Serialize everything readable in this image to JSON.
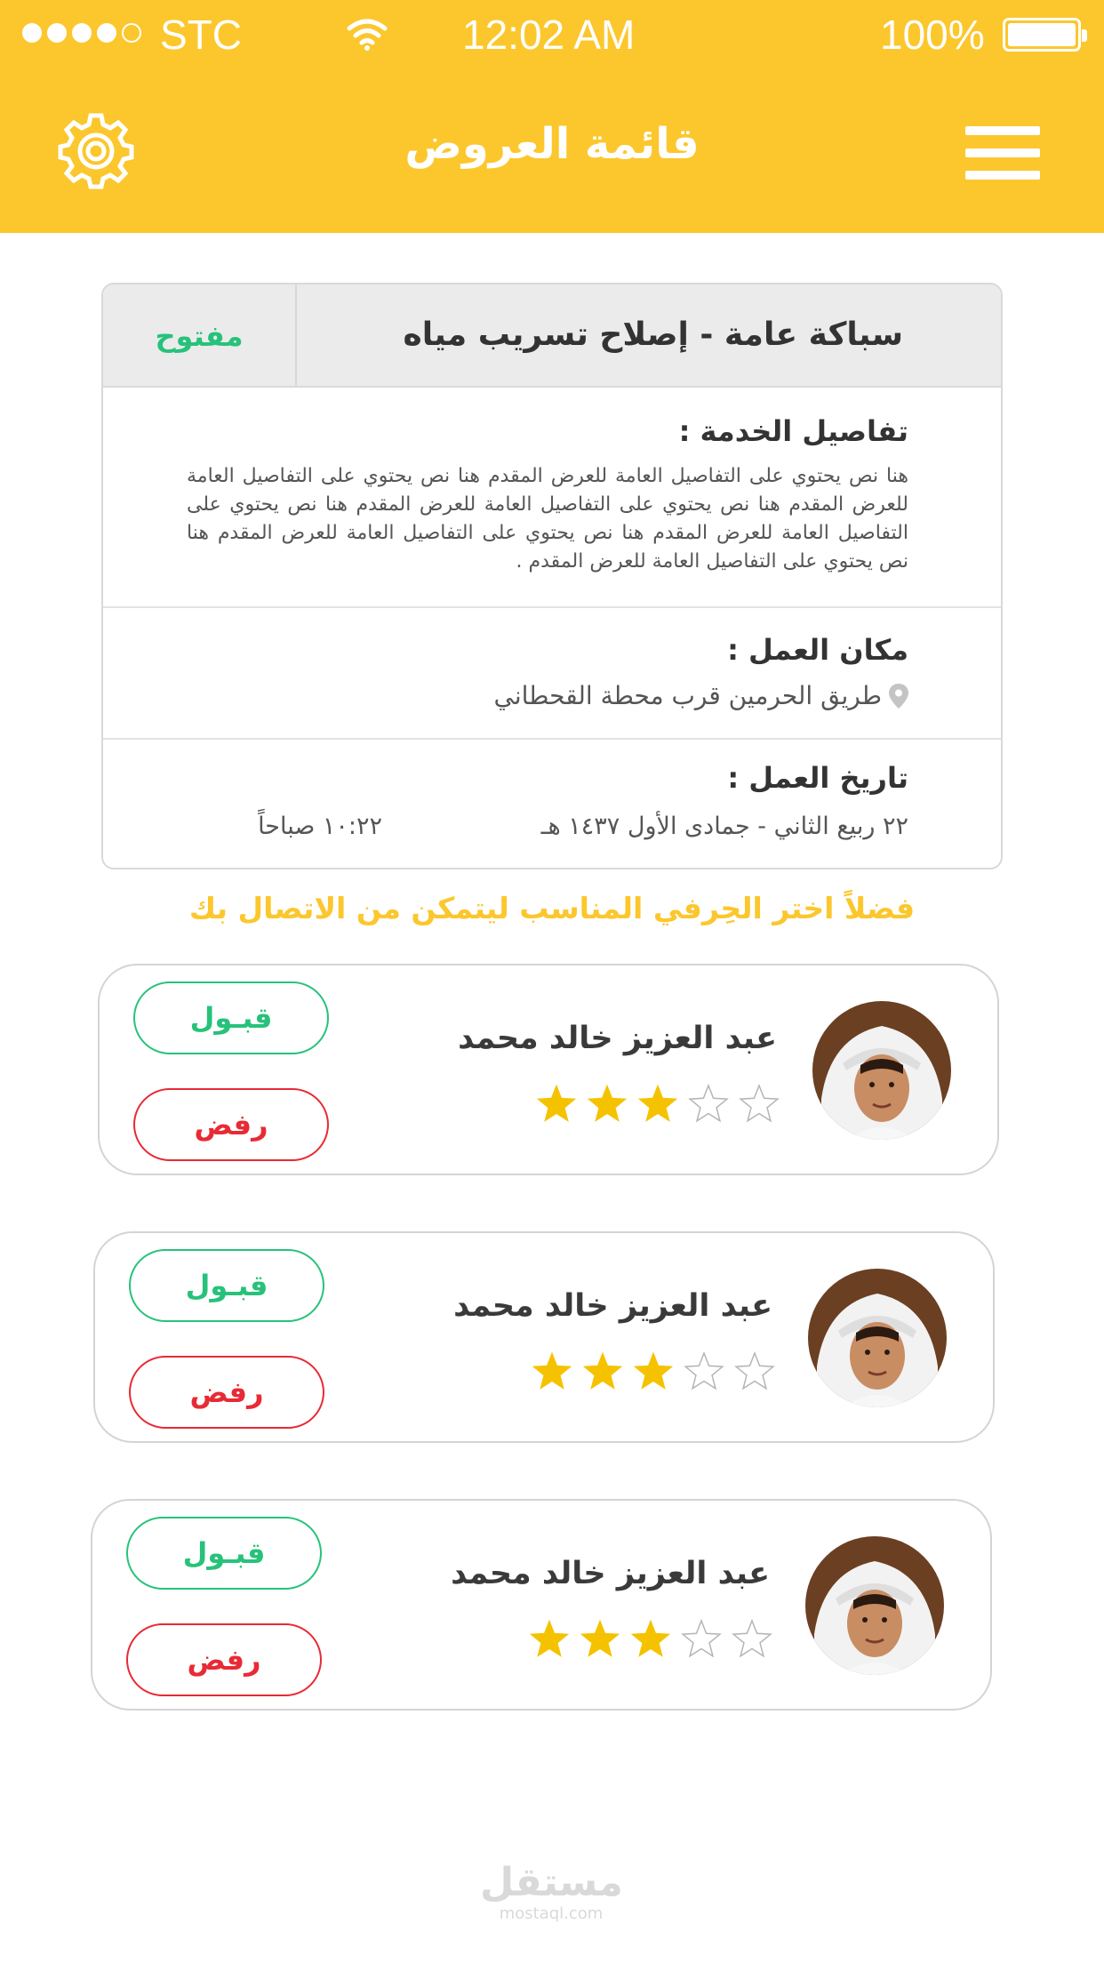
{
  "status_bar": {
    "carrier": "STC",
    "time": "12:02 AM",
    "battery_pct": "100%",
    "signal_bars": 4
  },
  "header": {
    "title": "قائمة العروض",
    "settings_icon": "gear-icon",
    "menu_icon": "hamburger-menu-icon",
    "color": "#fcc72d"
  },
  "request": {
    "service_title": "سباكة عامة - إصلاح تسريب مياه",
    "status": "مفتوح",
    "details_heading": "تفاصيل الخدمة :",
    "details_text": "هنا نص يحتوي على التفاصيل العامة للعرض المقدم هنا نص يحتوي على التفاصيل العامة للعرض المقدم هنا نص يحتوي على التفاصيل العامة للعرض المقدم هنا نص يحتوي على التفاصيل العامة للعرض المقدم هنا نص يحتوي على التفاصيل العامة للعرض المقدم هنا نص يحتوي على التفاصيل العامة للعرض المقدم .",
    "location_heading": "مكان العمل :",
    "location": "طريق الحرمين قرب محطة القحطاني",
    "location_icon": "map-pin-icon",
    "date_heading": "تاريخ العمل :",
    "date": "٢٢ ربيع الثاني - جمادى الأول ١٤٣٧ هـ",
    "time": "١٠:٢٢ صباحاً"
  },
  "prompt": "فضلاً اختر الحِرفي المناسب ليتمكن من الاتصال بك",
  "providers": [
    {
      "name": "عبد العزيز خالد محمد",
      "rating": 3,
      "max_rating": 5,
      "accept": "قبـول",
      "reject": "رفض"
    },
    {
      "name": "عبد العزيز خالد محمد",
      "rating": 3,
      "max_rating": 5,
      "accept": "قبـول",
      "reject": "رفض"
    },
    {
      "name": "عبد العزيز خالد محمد",
      "rating": 3,
      "max_rating": 5,
      "accept": "قبـول",
      "reject": "رفض"
    }
  ],
  "colors": {
    "accent": "#fcc72d",
    "accept": "#27c27a",
    "reject": "#e82a35",
    "star": "#f5c200"
  },
  "watermark": {
    "arabic": "مستقل",
    "latin": "mostaql.com"
  }
}
